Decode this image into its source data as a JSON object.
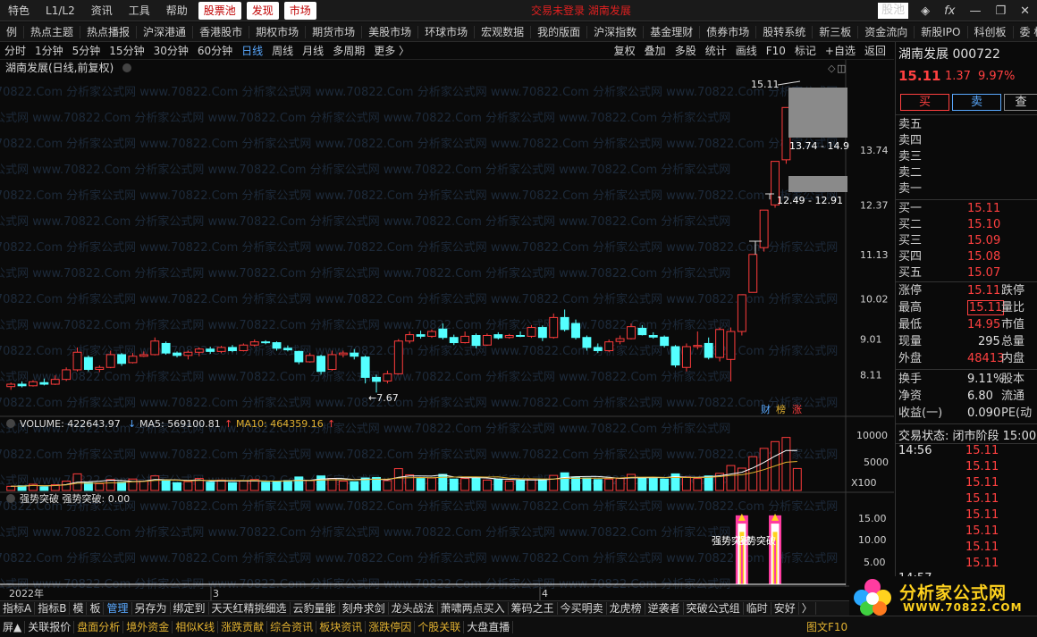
{
  "topbar": {
    "menu": [
      "特色",
      "L1/L2",
      "资讯",
      "工具",
      "帮助"
    ],
    "highlight": [
      "股票池",
      "发现",
      "市场"
    ],
    "center_text": "交易未登录  湖南发展",
    "right_badge": "股池",
    "right_icons": [
      "layers-icon",
      "fx-icon",
      "minimize-icon",
      "restore-icon",
      "close-icon"
    ]
  },
  "navbar": [
    "例",
    "热点主题",
    "热点播报",
    "沪深港通",
    "香港股市",
    "期权市场",
    "期货市场",
    "美股市场",
    "环球市场",
    "宏观数据",
    "我的版面",
    "沪深指数",
    "基金理财",
    "债券市场",
    "股转系统",
    "新三板",
    "资金流向",
    "新股IPO",
    "科创板",
    "委 标"
  ],
  "periodbar": {
    "periods": [
      "分时",
      "1分钟",
      "5分钟",
      "15分钟",
      "30分钟",
      "60分钟",
      "日线",
      "周线",
      "月线",
      "多周期",
      "更多 〉"
    ],
    "active": "日线",
    "tools": [
      "复权",
      "叠加",
      "多股",
      "统计",
      "画线",
      "F10",
      "标记",
      "+自选",
      "返回"
    ]
  },
  "chart": {
    "title": "湖南发展(日线,前复权)",
    "watermark": "www.70822.Com 分析家公式网",
    "price_axis": [
      "13.74",
      "12.37",
      "11.13",
      "10.02",
      "9.01",
      "8.11"
    ],
    "labels": {
      "high": "15.11",
      "low": "7.67",
      "range_upper": "13.74 - 14.9",
      "range_lower": "12.49 - 12.91",
      "badges": [
        "财",
        "榜",
        "涨"
      ]
    },
    "volume": {
      "vol_label": "VOLUME: 422643.97",
      "ma5_label": "MA5: 569100.81",
      "ma10_label": "MA10: 464359.16",
      "axis": [
        "10000",
        "5000"
      ],
      "unit": "X100"
    },
    "indicator": {
      "title": "强势突破  强势突破: 0.00",
      "axis": [
        "15.00",
        "10.00",
        "5.00"
      ],
      "annotation": "强势突破",
      "annotation2": "强势突破"
    },
    "x_axis": [
      "2022年",
      "3",
      "4"
    ]
  },
  "chart_data": {
    "type": "candlestick",
    "title": "湖南发展(日线,前复权)",
    "candles": [
      {
        "o": 7.82,
        "h": 7.92,
        "l": 7.74,
        "c": 7.88
      },
      {
        "o": 7.88,
        "h": 7.95,
        "l": 7.8,
        "c": 7.84
      },
      {
        "o": 7.84,
        "h": 7.98,
        "l": 7.82,
        "c": 7.94
      },
      {
        "o": 7.92,
        "h": 8.02,
        "l": 7.85,
        "c": 7.88
      },
      {
        "o": 7.88,
        "h": 8.1,
        "l": 7.86,
        "c": 8.0
      },
      {
        "o": 8.0,
        "h": 8.3,
        "l": 7.96,
        "c": 8.24
      },
      {
        "o": 8.24,
        "h": 8.8,
        "l": 8.2,
        "c": 8.68
      },
      {
        "o": 8.55,
        "h": 8.6,
        "l": 8.2,
        "c": 8.25
      },
      {
        "o": 8.25,
        "h": 8.35,
        "l": 8.18,
        "c": 8.3
      },
      {
        "o": 8.3,
        "h": 8.72,
        "l": 8.28,
        "c": 8.62
      },
      {
        "o": 8.62,
        "h": 8.66,
        "l": 8.34,
        "c": 8.4
      },
      {
        "o": 8.42,
        "h": 8.66,
        "l": 8.4,
        "c": 8.58
      },
      {
        "o": 8.58,
        "h": 8.7,
        "l": 8.56,
        "c": 8.62
      },
      {
        "o": 8.62,
        "h": 9.05,
        "l": 8.6,
        "c": 8.96
      },
      {
        "o": 8.9,
        "h": 8.95,
        "l": 8.62,
        "c": 8.66
      },
      {
        "o": 8.66,
        "h": 8.7,
        "l": 8.55,
        "c": 8.6
      },
      {
        "o": 8.6,
        "h": 8.72,
        "l": 8.5,
        "c": 8.68
      },
      {
        "o": 8.68,
        "h": 8.8,
        "l": 8.58,
        "c": 8.76
      },
      {
        "o": 8.76,
        "h": 8.82,
        "l": 8.64,
        "c": 8.7
      },
      {
        "o": 8.7,
        "h": 8.84,
        "l": 8.66,
        "c": 8.8
      },
      {
        "o": 8.8,
        "h": 8.86,
        "l": 8.68,
        "c": 8.72
      },
      {
        "o": 8.72,
        "h": 8.9,
        "l": 8.7,
        "c": 8.86
      },
      {
        "o": 8.86,
        "h": 9.0,
        "l": 8.82,
        "c": 8.94
      },
      {
        "o": 8.94,
        "h": 8.98,
        "l": 8.88,
        "c": 8.92
      },
      {
        "o": 8.92,
        "h": 8.95,
        "l": 8.72,
        "c": 8.78
      },
      {
        "o": 8.78,
        "h": 8.85,
        "l": 8.7,
        "c": 8.74
      },
      {
        "o": 8.7,
        "h": 8.72,
        "l": 8.38,
        "c": 8.44
      },
      {
        "o": 8.44,
        "h": 8.66,
        "l": 8.42,
        "c": 8.6
      },
      {
        "o": 8.58,
        "h": 8.62,
        "l": 8.12,
        "c": 8.2
      },
      {
        "o": 8.25,
        "h": 8.72,
        "l": 8.22,
        "c": 8.62
      },
      {
        "o": 8.62,
        "h": 8.72,
        "l": 8.55,
        "c": 8.66
      },
      {
        "o": 8.66,
        "h": 8.76,
        "l": 8.5,
        "c": 8.58
      },
      {
        "o": 8.56,
        "h": 8.6,
        "l": 7.9,
        "c": 8.05
      },
      {
        "o": 8.05,
        "h": 8.12,
        "l": 7.67,
        "c": 7.95
      },
      {
        "o": 7.96,
        "h": 8.22,
        "l": 7.9,
        "c": 8.14
      },
      {
        "o": 8.14,
        "h": 9.01,
        "l": 8.12,
        "c": 8.96
      },
      {
        "o": 8.96,
        "h": 9.2,
        "l": 8.9,
        "c": 9.12
      },
      {
        "o": 9.12,
        "h": 9.22,
        "l": 9.02,
        "c": 9.08
      },
      {
        "o": 9.08,
        "h": 9.25,
        "l": 9.04,
        "c": 9.2
      },
      {
        "o": 9.26,
        "h": 9.4,
        "l": 9.0,
        "c": 9.05
      },
      {
        "o": 9.05,
        "h": 9.12,
        "l": 8.86,
        "c": 8.92
      },
      {
        "o": 8.92,
        "h": 9.2,
        "l": 8.9,
        "c": 9.08
      },
      {
        "o": 9.1,
        "h": 9.15,
        "l": 8.78,
        "c": 8.85
      },
      {
        "o": 8.86,
        "h": 9.15,
        "l": 8.84,
        "c": 9.1
      },
      {
        "o": 9.12,
        "h": 9.18,
        "l": 9.0,
        "c": 9.04
      },
      {
        "o": 9.05,
        "h": 9.14,
        "l": 9.02,
        "c": 9.1
      },
      {
        "o": 9.1,
        "h": 9.2,
        "l": 9.06,
        "c": 9.08
      },
      {
        "o": 9.08,
        "h": 9.36,
        "l": 9.04,
        "c": 9.3
      },
      {
        "o": 9.3,
        "h": 9.35,
        "l": 8.96,
        "c": 9.05
      },
      {
        "o": 9.05,
        "h": 9.65,
        "l": 9.02,
        "c": 9.55
      },
      {
        "o": 9.55,
        "h": 9.75,
        "l": 9.2,
        "c": 9.25
      },
      {
        "o": 9.4,
        "h": 9.5,
        "l": 9.0,
        "c": 9.05
      },
      {
        "o": 9.05,
        "h": 9.1,
        "l": 8.72,
        "c": 8.8
      },
      {
        "o": 8.8,
        "h": 8.9,
        "l": 8.66,
        "c": 8.72
      },
      {
        "o": 8.72,
        "h": 9.0,
        "l": 8.68,
        "c": 8.94
      },
      {
        "o": 8.95,
        "h": 9.1,
        "l": 8.88,
        "c": 9.02
      },
      {
        "o": 9.02,
        "h": 9.4,
        "l": 9.0,
        "c": 9.32
      },
      {
        "o": 9.28,
        "h": 9.36,
        "l": 9.1,
        "c": 9.12
      },
      {
        "o": 9.1,
        "h": 9.18,
        "l": 9.02,
        "c": 9.06
      },
      {
        "o": 9.06,
        "h": 9.1,
        "l": 8.8,
        "c": 8.85
      },
      {
        "o": 8.82,
        "h": 8.86,
        "l": 8.3,
        "c": 8.36
      },
      {
        "o": 8.3,
        "h": 8.9,
        "l": 8.2,
        "c": 8.82
      },
      {
        "o": 8.82,
        "h": 9.2,
        "l": 8.75,
        "c": 8.85
      },
      {
        "o": 8.9,
        "h": 9.05,
        "l": 8.5,
        "c": 8.55
      },
      {
        "o": 8.55,
        "h": 9.3,
        "l": 8.45,
        "c": 9.25
      },
      {
        "o": 8.5,
        "h": 9.3,
        "l": 7.95,
        "c": 9.2
      },
      {
        "o": 9.2,
        "h": 10.12,
        "l": 9.1,
        "c": 10.12
      },
      {
        "o": 10.18,
        "h": 11.13,
        "l": 10.8,
        "c": 11.13
      },
      {
        "o": 11.3,
        "h": 12.24,
        "l": 11.2,
        "c": 12.24
      },
      {
        "o": 12.37,
        "h": 13.46,
        "l": 12.3,
        "c": 13.46
      },
      {
        "o": 13.5,
        "h": 14.8,
        "l": 13.4,
        "c": 14.81
      },
      {
        "o": 14.95,
        "h": 15.11,
        "l": 14.95,
        "c": 15.11
      }
    ],
    "volume_hundreds": [
      800,
      900,
      1200,
      700,
      1100,
      1800,
      3200,
      1500,
      1300,
      2100,
      1600,
      2200,
      1800,
      2800,
      1900,
      1500,
      1700,
      2300,
      1600,
      2000,
      1500,
      1900,
      2100,
      1600,
      1800,
      1900,
      2600,
      1900,
      2800,
      2300,
      1800,
      1700,
      2400,
      2500,
      1900,
      4200,
      3000,
      2300,
      2400,
      3100,
      2200,
      2300,
      2400,
      2000,
      2200,
      1800,
      1900,
      2200,
      2100,
      2900,
      3400,
      2600,
      2400,
      2100,
      2200,
      2300,
      3100,
      2500,
      2300,
      2200,
      3200,
      2600,
      2300,
      2800,
      3300,
      4800,
      4300,
      6500,
      8100,
      9400,
      10200,
      4226
    ],
    "ma5_hundreds": 5691,
    "ma10_hundreds": 4643,
    "indicator_values": [
      0,
      0,
      0,
      0,
      0,
      0,
      0,
      0,
      0,
      0,
      0,
      0,
      0,
      0,
      0,
      0,
      0,
      0,
      0,
      0,
      0,
      0,
      0,
      0,
      0,
      0,
      0,
      0,
      0,
      0,
      0,
      0,
      0,
      0,
      0,
      0,
      0,
      0,
      0,
      0,
      0,
      0,
      0,
      0,
      0,
      0,
      0,
      0,
      0,
      0,
      0,
      0,
      0,
      0,
      0,
      0,
      0,
      0,
      0,
      0,
      0,
      0,
      0,
      0,
      0,
      0,
      16,
      0,
      0,
      16,
      0,
      0
    ],
    "ylim_price": [
      7.5,
      15.6
    ],
    "ylim_volume": [
      0,
      11000
    ],
    "ylim_indicator": [
      0,
      17
    ]
  },
  "quote": {
    "name_code": "湖南发展 000722",
    "price": "15.11",
    "change": "1.37",
    "pct": "9.97%",
    "buy": "买",
    "sell": "卖",
    "search": "查",
    "asks": [
      "卖五",
      "卖四",
      "卖三",
      "卖二",
      "卖一"
    ],
    "bids": [
      {
        "l": "买一",
        "v": "15.11"
      },
      {
        "l": "买二",
        "v": "15.10"
      },
      {
        "l": "买三",
        "v": "15.09"
      },
      {
        "l": "买四",
        "v": "15.08"
      },
      {
        "l": "买五",
        "v": "15.07"
      }
    ],
    "stats": [
      {
        "l": "涨停",
        "v": "15.11",
        "c": "跌停"
      },
      {
        "l": "最高",
        "v": "15.11",
        "c": "量比"
      },
      {
        "l": "最低",
        "v": "14.95",
        "c": "市值"
      },
      {
        "l": "现量",
        "v": "295",
        "c": "总量"
      },
      {
        "l": "外盘",
        "v": "48413",
        "c": "内盘"
      }
    ],
    "stats2": [
      {
        "l": "换手",
        "v": "9.11%",
        "c": "股本"
      },
      {
        "l": "净资",
        "v": "6.80",
        "c": "流通"
      },
      {
        "l": "收益(一)",
        "v": "0.090",
        "c": "PE(动"
      }
    ],
    "trade_state": "交易状态: 闭市阶段 15:00",
    "tick_time": "14:56",
    "tick_time2": "14:57",
    "ticks": [
      "15.11",
      "15.11",
      "15.11",
      "15.11",
      "15.11",
      "15.11",
      "15.11",
      "15.11"
    ]
  },
  "tabbar": [
    "指标A",
    "指标B",
    "模",
    "板",
    "管理",
    "另存为",
    "绑定到",
    "天天红精挑细选",
    "云豹量能",
    "刻舟求剑",
    "龙头战法",
    "萧啸两点买入",
    "筹码之王",
    "今买明卖",
    "龙虎榜",
    "逆袭者",
    "突破公式组",
    "临时",
    "安好",
    "〉"
  ],
  "statusbar": [
    "屏▲",
    "关联报价",
    "盘面分析",
    "境外资金",
    "相似K线",
    "涨跌贡献",
    "综合资讯",
    "板块资讯",
    "涨跌停因",
    "个股关联",
    "大盘直播"
  ],
  "statusbar_right": "图文F10",
  "logo": {
    "title": "分析家公式网",
    "url": "WWW.70822.COM"
  }
}
